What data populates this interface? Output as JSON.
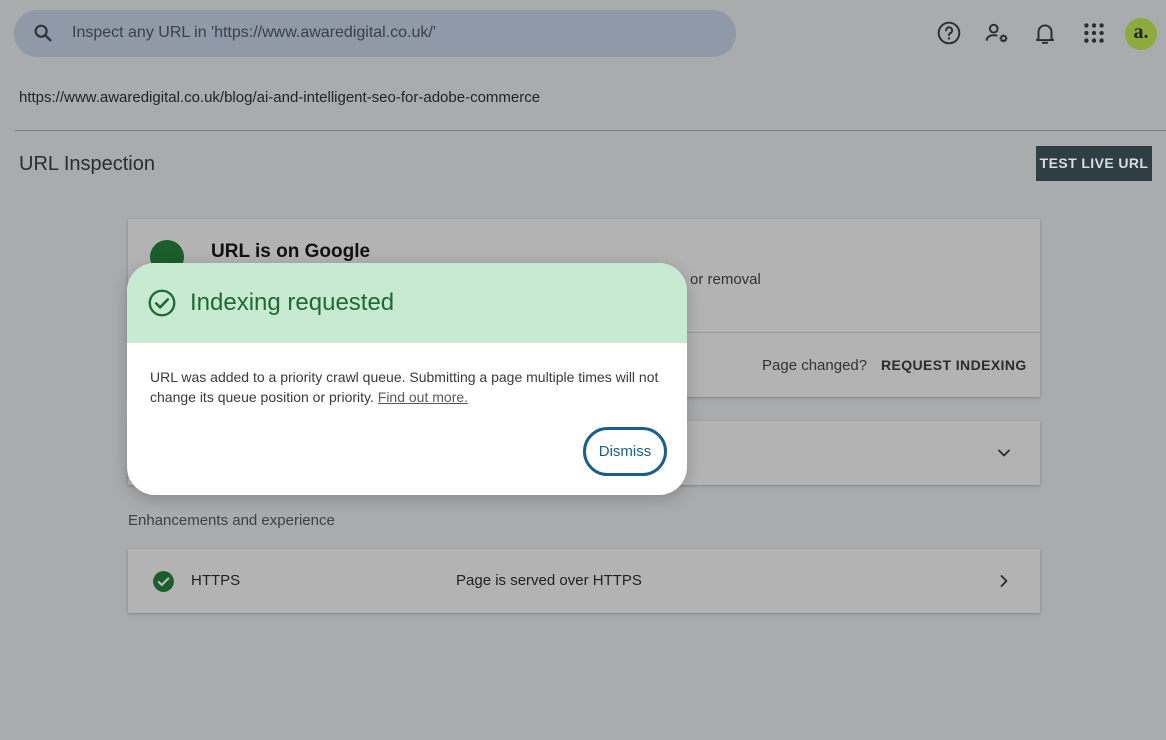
{
  "header": {
    "search_placeholder": "Inspect any URL in 'https://www.awaredigital.co.uk/'",
    "icons": [
      "help-icon",
      "manage-users-icon",
      "notifications-icon",
      "apps-grid-icon"
    ],
    "avatar_letter": "a."
  },
  "page": {
    "url": "https://www.awaredigital.co.uk/blog/ai-and-intelligent-seo-for-adobe-commerce",
    "title": "URL Inspection",
    "test_live_url_label": "TEST LIVE URL"
  },
  "status_card": {
    "title": "URL is on Google",
    "subtitle_fragment": "or removal",
    "page_changed_label": "Page changed?",
    "request_indexing_label": "REQUEST INDEXING"
  },
  "enhancements": {
    "section_label": "Enhancements and experience",
    "items": [
      {
        "name": "HTTPS",
        "status": "Page is served over HTTPS"
      }
    ]
  },
  "dialog": {
    "title": "Indexing requested",
    "body": "URL was added to a priority crawl queue. Submitting a page multiple times will not change its queue position or priority.",
    "link_label": "Find out more.",
    "dismiss_label": "Dismiss"
  },
  "colors": {
    "accent_dark": "#2f3d44",
    "success_green": "#1b5e2b",
    "dialog_header_bg": "#c8ead3",
    "dismiss_blue": "#1a5e8e"
  }
}
